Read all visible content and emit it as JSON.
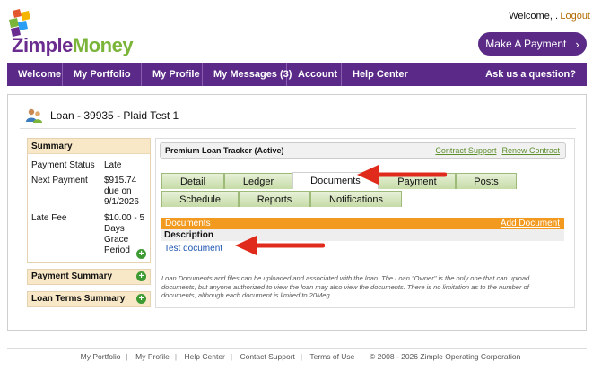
{
  "brand": {
    "name_part1": "Zimple",
    "name_part2": "Money",
    "colors": {
      "purple": "#5b2a88",
      "green": "#7ab53a",
      "orange": "#f29a1f"
    }
  },
  "header": {
    "welcome": "Welcome, .",
    "logout": "Logout",
    "pay_button": "Make A Payment",
    "pay_icon": "chevron-right-icon"
  },
  "nav": {
    "items": [
      "Welcome",
      "My Portfolio",
      "My Profile",
      "My Messages (3)",
      "Account",
      "Help Center"
    ],
    "ask": "Ask us a question?"
  },
  "loan": {
    "title": "Loan - 39935 - Plaid Test 1",
    "icon": "users-icon"
  },
  "summary": {
    "heading": "Summary",
    "rows": [
      {
        "label": "Payment Status",
        "value": "Late"
      },
      {
        "label": "Next Payment",
        "value": "$915.74 due on 9/1/2026"
      },
      {
        "label": "Late Fee",
        "value": "$10.00 - 5 Days Grace Period"
      }
    ]
  },
  "accordions": {
    "payment_summary": "Payment Summary",
    "loan_terms": "Loan Terms Summary"
  },
  "tracker": {
    "title": "Premium Loan Tracker (Active)",
    "contract_support": "Contract Support",
    "renew_contract": "Renew Contract"
  },
  "tabs": {
    "row1": [
      "Detail",
      "Ledger",
      "Documents",
      "Payment",
      "Posts"
    ],
    "row2": [
      "Schedule",
      "Reports",
      "Notifications"
    ],
    "active": "Documents"
  },
  "documents": {
    "heading": "Documents",
    "add": "Add Document",
    "column": "Description",
    "items": [
      "Test document"
    ],
    "note": "Loan Documents and files can be uploaded and associated with the loan. The Loan \"Owner\" is the only one that can upload documents, but anyone authorized to view the loan may also view the documents. There is no limitation as to the number of documents, although each document is limited to 20Meg."
  },
  "footer": {
    "links": [
      "My Portfolio",
      "My Profile",
      "Help Center",
      "Contact Support",
      "Terms of Use"
    ],
    "copyright": "© 2008 - 2026 Zimple Operating Corporation"
  }
}
